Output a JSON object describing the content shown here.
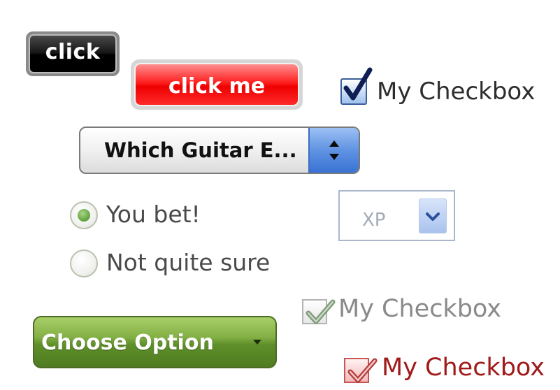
{
  "buttons": {
    "black_label": "click",
    "red_label": "click me",
    "green_label": "Choose Option"
  },
  "checkboxes": [
    {
      "label": "My Checkbox",
      "checked": true,
      "style": "blue"
    },
    {
      "label": "My Checkbox",
      "checked": true,
      "style": "grey"
    },
    {
      "label": "My Checkbox",
      "checked": true,
      "style": "red"
    }
  ],
  "select_guitar": {
    "value": "Which Guitar E..."
  },
  "radios": [
    {
      "label": "You bet!",
      "checked": true
    },
    {
      "label": "Not quite sure",
      "checked": false
    }
  ],
  "select_os": {
    "value": "XP"
  },
  "icons": {
    "checkmark": "checkmark-icon",
    "spinner_arrows": "up-down-arrows-icon",
    "chevron": "chevron-down-icon",
    "caret": "caret-down-icon"
  },
  "colors": {
    "red_button": "#ff2020",
    "green_button": "#6a9a30",
    "blue_accent": "#3a72d4",
    "checkbox_red_text": "#a11a1a"
  }
}
